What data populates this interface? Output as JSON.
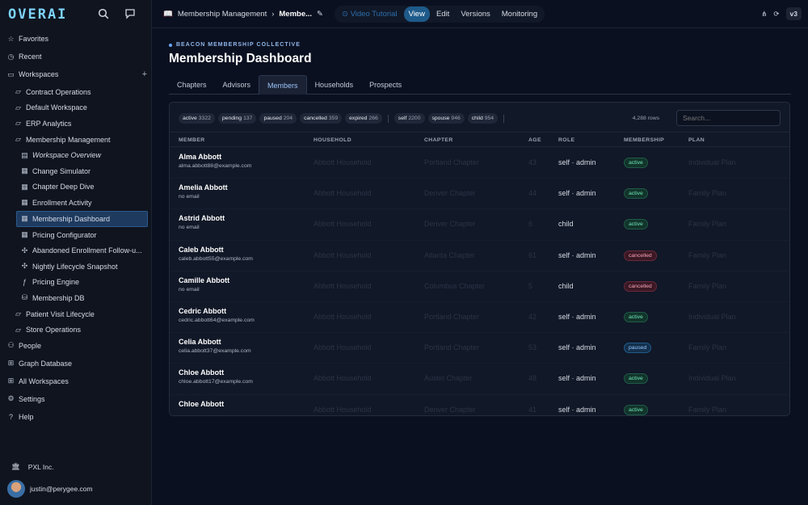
{
  "app": {
    "logo": "OVERAI"
  },
  "sidebar": {
    "items": [
      {
        "label": "Favorites",
        "icon": "star-icon"
      },
      {
        "label": "Recent",
        "icon": "clock-icon"
      },
      {
        "label": "Workspaces",
        "icon": "workspaces-icon"
      }
    ],
    "workspaces": [
      {
        "label": "Contract Operations"
      },
      {
        "label": "Default Workspace"
      },
      {
        "label": "ERP Analytics"
      },
      {
        "label": "Membership Management"
      }
    ],
    "membership_children": [
      {
        "label": "Workspace Overview",
        "italic": true,
        "icon": "overview-icon"
      },
      {
        "label": "Change Simulator",
        "icon": "table-icon"
      },
      {
        "label": "Chapter Deep Dive",
        "icon": "table-icon"
      },
      {
        "label": "Enrollment Activity",
        "icon": "table-icon"
      },
      {
        "label": "Membership Dashboard",
        "icon": "table-icon",
        "active": true
      },
      {
        "label": "Pricing Configurator",
        "icon": "table-icon"
      },
      {
        "label": "Abandoned Enrollment Follow-u...",
        "icon": "workflow-icon"
      },
      {
        "label": "Nightly Lifecycle Snapshot",
        "icon": "workflow-icon"
      },
      {
        "label": "Pricing Engine",
        "icon": "function-icon"
      },
      {
        "label": "Membership DB",
        "icon": "database-icon"
      }
    ],
    "more_workspaces": [
      {
        "label": "Patient Visit Lifecycle"
      },
      {
        "label": "Store Operations"
      }
    ],
    "bottom": [
      {
        "label": "People",
        "icon": "people-icon"
      },
      {
        "label": "Graph Database",
        "icon": "graph-icon"
      },
      {
        "label": "All Workspaces",
        "icon": "grid-icon"
      },
      {
        "label": "Settings",
        "icon": "gear-icon"
      },
      {
        "label": "Help",
        "icon": "help-icon"
      }
    ],
    "org": "PXL Inc.",
    "user_email": "justin@perygee.com"
  },
  "topbar": {
    "breadcrumb_parent": "Membership Management",
    "breadcrumb_current": "Membe...",
    "tabs": [
      "Video Tutorial",
      "View",
      "Edit",
      "Versions",
      "Monitoring"
    ],
    "version": "v3"
  },
  "page": {
    "org_label": "BEACON MEMBERSHIP COLLECTIVE",
    "title": "Membership Dashboard",
    "tabs": [
      "Chapters",
      "Advisors",
      "Members",
      "Households",
      "Prospects"
    ],
    "active_tab": "Members"
  },
  "filters": {
    "status": [
      {
        "label": "active",
        "count": "3322"
      },
      {
        "label": "pending",
        "count": "137"
      },
      {
        "label": "paused",
        "count": "204"
      },
      {
        "label": "cancelled",
        "count": "359"
      },
      {
        "label": "expired",
        "count": "266"
      }
    ],
    "role": [
      {
        "label": "self",
        "count": "2200"
      },
      {
        "label": "spouse",
        "count": "946"
      },
      {
        "label": "child",
        "count": "954"
      }
    ],
    "row_count": "4,288 rows",
    "search_placeholder": "Search..."
  },
  "table": {
    "columns": [
      "MEMBER",
      "HOUSEHOLD",
      "CHAPTER",
      "AGE",
      "ROLE",
      "MEMBERSHIP",
      "PLAN"
    ],
    "rows": [
      {
        "name": "Alma Abbott",
        "email": "alma.abbott88@example.com",
        "household": "Abbott Household",
        "chapter": "Portland Chapter",
        "age": "43",
        "role": "self · admin",
        "membership": "active",
        "plan": "Individual Plan"
      },
      {
        "name": "Amelia Abbott",
        "email": "no email",
        "household": "Abbott Household",
        "chapter": "Denver Chapter",
        "age": "44",
        "role": "self · admin",
        "membership": "active",
        "plan": "Family Plan"
      },
      {
        "name": "Astrid Abbott",
        "email": "no email",
        "household": "Abbott Household",
        "chapter": "Denver Chapter",
        "age": "6",
        "role": "child",
        "membership": "active",
        "plan": "Family Plan"
      },
      {
        "name": "Caleb Abbott",
        "email": "caleb.abbott55@example.com",
        "household": "Abbott Household",
        "chapter": "Atlanta Chapter",
        "age": "61",
        "role": "self · admin",
        "membership": "cancelled",
        "plan": "Family Plan"
      },
      {
        "name": "Camille Abbott",
        "email": "no email",
        "household": "Abbott Household",
        "chapter": "Columbus Chapter",
        "age": "5",
        "role": "child",
        "membership": "cancelled",
        "plan": "Family Plan"
      },
      {
        "name": "Cedric Abbott",
        "email": "cedric.abbott64@example.com",
        "household": "Abbott Household",
        "chapter": "Portland Chapter",
        "age": "42",
        "role": "self · admin",
        "membership": "active",
        "plan": "Individual Plan"
      },
      {
        "name": "Celia Abbott",
        "email": "celia.abbott37@example.com",
        "household": "Abbott Household",
        "chapter": "Portland Chapter",
        "age": "53",
        "role": "self · admin",
        "membership": "paused",
        "plan": "Family Plan"
      },
      {
        "name": "Chloe Abbott",
        "email": "chloe.abbott17@example.com",
        "household": "Abbott Household",
        "chapter": "Austin Chapter",
        "age": "48",
        "role": "self · admin",
        "membership": "active",
        "plan": "Individual Plan"
      },
      {
        "name": "Chloe Abbott",
        "email": "",
        "household": "Abbott Household",
        "chapter": "Denver Chapter",
        "age": "41",
        "role": "self · admin",
        "membership": "active",
        "plan": "Family Plan"
      }
    ]
  }
}
